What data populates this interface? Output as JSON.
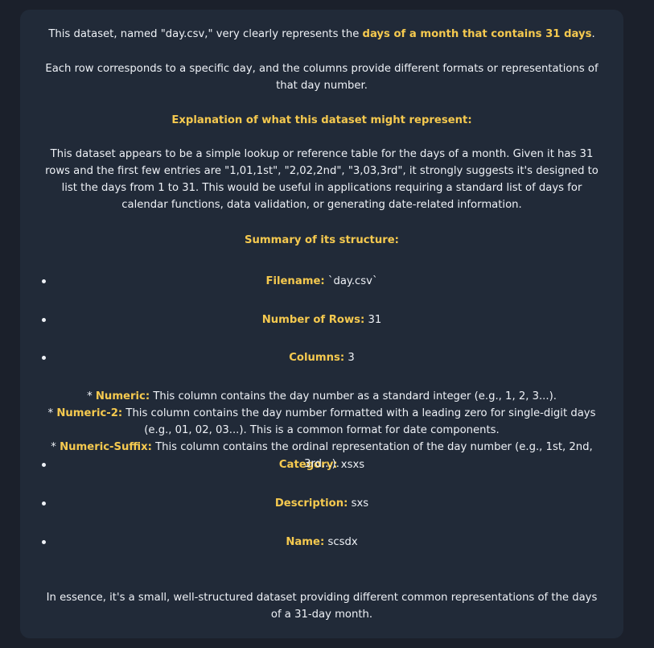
{
  "intro": {
    "before": "This dataset, named \"day.csv,\" very clearly represents the ",
    "highlight": "days of a month that contains 31 days",
    "after": "."
  },
  "paragraph_rows": "Each row corresponds to a specific day, and the columns provide different formats or representations of that day number.",
  "explanation_heading": "Explanation of what this dataset might represent:",
  "explanation_body": "This dataset appears to be a simple lookup or reference table for the days of a month. Given it has 31 rows and the first few entries are \"1,01,1st\", \"2,02,2nd\", \"3,03,3rd\", it strongly suggests it's designed to list the days from 1 to 31. This would be useful in applications requiring a standard list of days for calendar functions, data validation, or generating date-related information.",
  "summary_heading": "Summary of its structure:",
  "summary_items": [
    {
      "label": "Filename:",
      "value": " `day.csv`"
    },
    {
      "label": "Number of Rows:",
      "value": " 31"
    },
    {
      "label": "Columns:",
      "value": " 3"
    },
    {
      "label": "Category:",
      "value": " xsxs"
    },
    {
      "label": "Description:",
      "value": " sxs"
    },
    {
      "label": "Name:",
      "value": " scsdx"
    }
  ],
  "columns_detail": [
    {
      "prefix": "* ",
      "label": "Numeric:",
      "text": " This column contains the day number as a standard integer (e.g., 1, 2, 3...)."
    },
    {
      "prefix": "* ",
      "label": "Numeric-2:",
      "text": " This column contains the day number formatted with a leading zero for single-digit days (e.g., 01, 02, 03...). This is a common format for date components."
    },
    {
      "prefix": "* ",
      "label": "Numeric-Suffix:",
      "text": " This column contains the ordinal representation of the day number (e.g., 1st, 2nd, 3rd...)."
    }
  ],
  "closing": "In essence, it's a small, well-structured dataset providing different common representations of the days of a 31-day month.",
  "colors": {
    "background": "#1b202b",
    "card": "#212a38",
    "text": "#eef1f6",
    "highlight": "#f5c94f"
  }
}
